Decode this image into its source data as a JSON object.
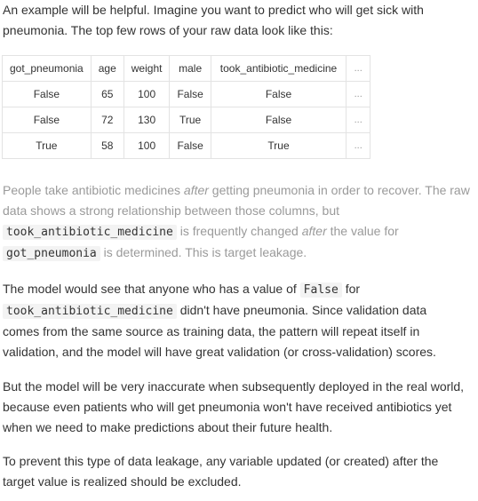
{
  "intro": {
    "line1": "An example will be helpful. Imagine you want to predict who will get sick with",
    "line2": "pneumonia. The top few rows of your raw data look like this:"
  },
  "table": {
    "headers": [
      "got_pneumonia",
      "age",
      "weight",
      "male",
      "took_antibiotic_medicine",
      "..."
    ],
    "rows": [
      [
        "False",
        "65",
        "100",
        "False",
        "False",
        "..."
      ],
      [
        "False",
        "72",
        "130",
        "True",
        "False",
        "..."
      ],
      [
        "True",
        "58",
        "100",
        "False",
        "True",
        "..."
      ]
    ]
  },
  "p2": {
    "a": "People take antibiotic medicines ",
    "after1": "after",
    "b": " getting pneumonia in order to recover. The raw",
    "c": "data shows a strong relationship between those columns, but",
    "code1": "took_antibiotic_medicine",
    "d": " is frequently changed ",
    "after2": "after",
    "e": " the value for",
    "code2": "got_pneumonia",
    "f": " is determined. This is target leakage."
  },
  "p3": {
    "a": "The model would see that anyone who has a value of ",
    "code1": "False",
    "b": " for",
    "code2": "took_antibiotic_medicine",
    "c": " didn't have pneumonia. Since validation data",
    "d": "comes from the same source as training data, the pattern will repeat itself in",
    "e": "validation, and the model will have great validation (or cross-validation) scores."
  },
  "p4": {
    "a": "But the model will be very inaccurate when subsequently deployed in the real world,",
    "b": "because even patients who will get pneumonia won't have received antibiotics yet",
    "c": "when we need to make predictions about their future health."
  },
  "p5": {
    "a": "To prevent this type of data leakage, any variable updated (or created) after the",
    "b": "target value is realized should be excluded."
  }
}
